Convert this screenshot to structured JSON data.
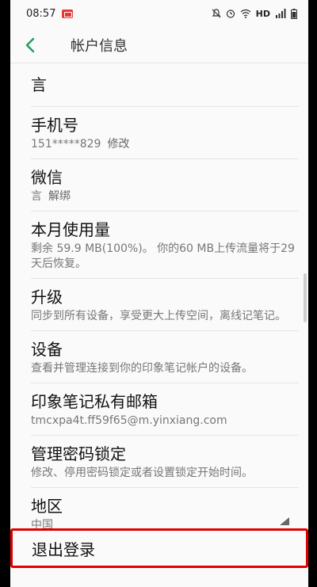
{
  "status_bar": {
    "time": "08:57",
    "right_text": "HD"
  },
  "header": {
    "title": "帐户信息"
  },
  "items": [
    {
      "title": "言"
    },
    {
      "title": "手机号",
      "sub": "151*****829",
      "link": "修改"
    },
    {
      "title": "微信",
      "sub": "言",
      "link": "解绑"
    },
    {
      "title": "本月使用量",
      "sub": "剩余 59.9 MB(100%)。 你的60 MB上传流量将于29天后恢复。"
    },
    {
      "title": "升级",
      "sub": "同步到所有设备，享受更大上传空间，离线记笔记。"
    },
    {
      "title": "设备",
      "sub": "查看并管理连接到你的印象笔记帐户的设备。"
    },
    {
      "title": "印象笔记私有邮箱",
      "sub": "tmcxpa4t.ff59f65@m.yinxiang.com"
    },
    {
      "title": "管理密码锁定",
      "sub": "修改、停用密码锁定或者设置锁定开始时间。"
    },
    {
      "title": "地区",
      "sub": "中国"
    }
  ],
  "logout": {
    "label": "退出登录"
  },
  "colors": {
    "accent": "#1e9e5a",
    "highlight": "#e00000"
  }
}
